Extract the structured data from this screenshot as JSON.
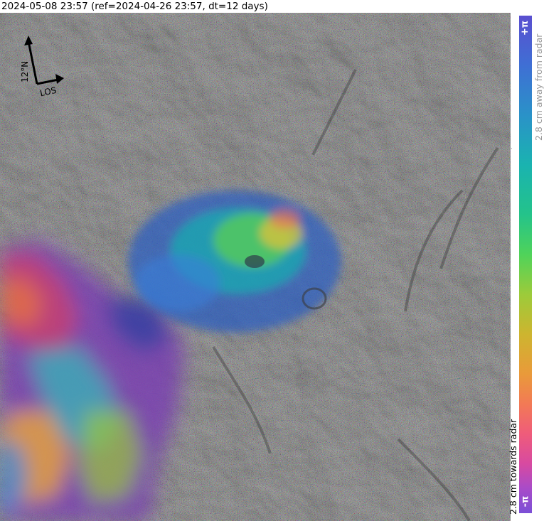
{
  "header": {
    "title": "2024-05-08 23:57 (ref=2024-04-26 23:57, dt=12 days)"
  },
  "compass": {
    "north_label": "12°N",
    "los_label": "LOS"
  },
  "colorbar": {
    "top_label": "+π",
    "bottom_label": "-π",
    "away_label": "2.8 cm away from radar",
    "towards_label": "2.8 cm towards radar",
    "stops": [
      "#5a4fd0",
      "#2a92c8",
      "#24c38a",
      "#4fd35a",
      "#cdb52f",
      "#f27a55",
      "#d84aa0",
      "#7b4fd6"
    ]
  },
  "colors": {
    "background": "#7d7d7d",
    "away_text": "#9a9a9a",
    "towards_text": "#000000"
  }
}
